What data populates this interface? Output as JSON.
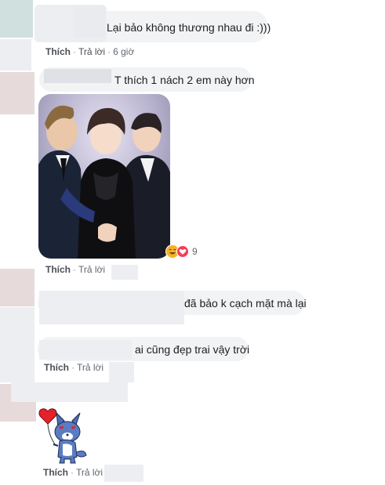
{
  "comments": [
    {
      "text": "Lại bảo không thương nhau đi :)))",
      "actions": {
        "like": "Thích",
        "reply": "Trả lời",
        "time": "6 giờ"
      }
    },
    {
      "text": "T thích 1 nách 2 em này hơn",
      "reactions": {
        "count": "9"
      },
      "actions": {
        "like": "Thích",
        "reply": "Trả lời"
      }
    },
    {
      "text": "đã bảo k cạch mặt mà lại"
    },
    {
      "text": "ai cũng đẹp trai vậy trời",
      "actions": {
        "like": "Thích",
        "reply": "Trả lời"
      }
    },
    {
      "actions": {
        "like": "Thích",
        "reply": "Trả lời"
      }
    }
  ]
}
